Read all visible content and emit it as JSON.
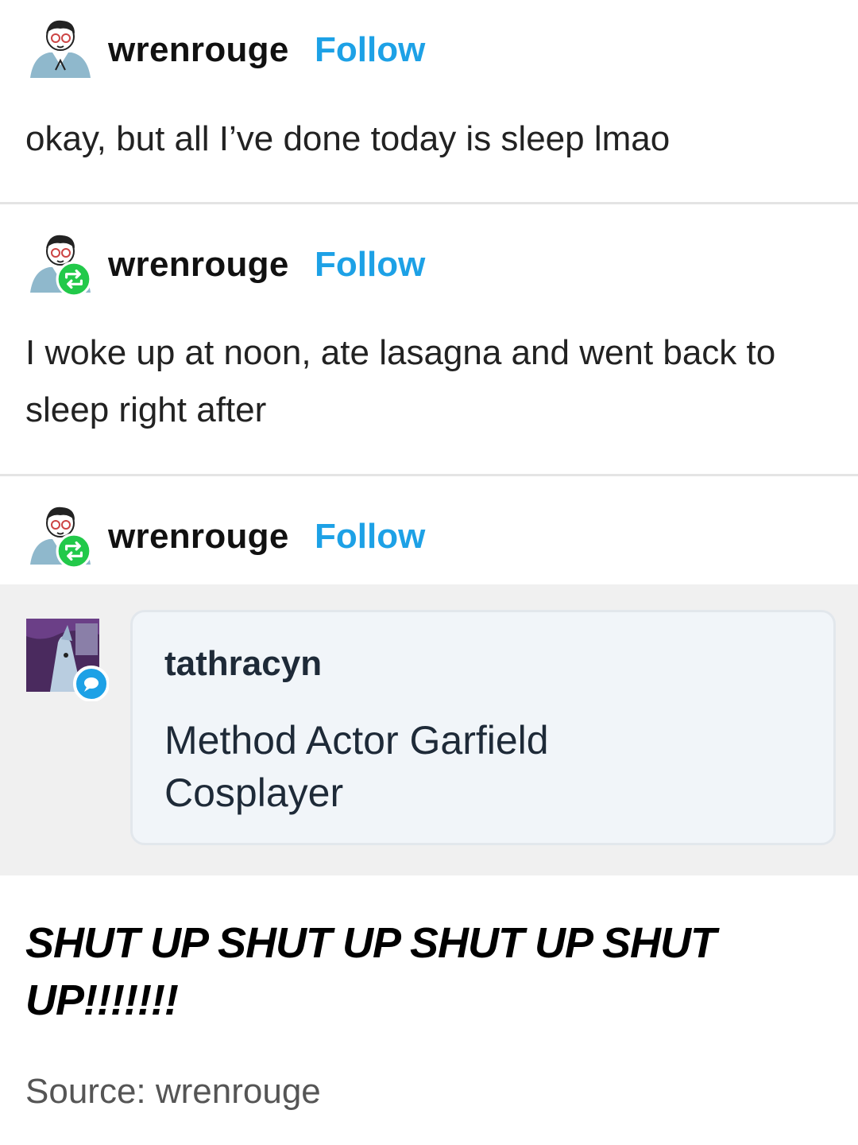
{
  "posts": [
    {
      "username": "wrenrouge",
      "follow_label": "Follow",
      "body": "okay, but all I’ve done today is sleep lmao",
      "reblog_badge": false
    },
    {
      "username": "wrenrouge",
      "follow_label": "Follow",
      "body": "I woke up at noon, ate lasagna and went back to sleep right after",
      "reblog_badge": true
    },
    {
      "username": "wrenrouge",
      "follow_label": "Follow",
      "reblog_badge": true
    }
  ],
  "quote": {
    "username": "tathracyn",
    "body": "Method Actor Garfield Cosplayer",
    "badge_icon": "chat-bubble-icon"
  },
  "shout": "SHUT UP SHUT UP SHUT UP SHUT UP!!!!!!!",
  "source": "Source: wrenrouge",
  "colors": {
    "follow": "#1da1e6",
    "reblog_badge": "#22c94a",
    "quote_badge": "#1da1e6",
    "quote_background": "#f0f0f0",
    "divider": "#e4e4e4"
  }
}
